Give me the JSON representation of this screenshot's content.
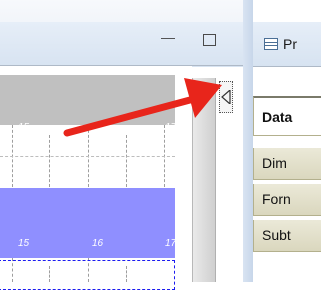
{
  "left_panel": {
    "minimize_glyph": "—",
    "ruler_top": [
      "15",
      "",
      "17"
    ],
    "ruler_bottom": [
      "15",
      "16",
      "17"
    ]
  },
  "properties_panel": {
    "title": "Pr",
    "header": "Data",
    "rows": [
      "Dim",
      "Forn",
      "Subt"
    ]
  },
  "colors": {
    "gray_band": "#c0c0c0",
    "blue_band": "#8f8fff",
    "arrow": "#e8251b"
  }
}
